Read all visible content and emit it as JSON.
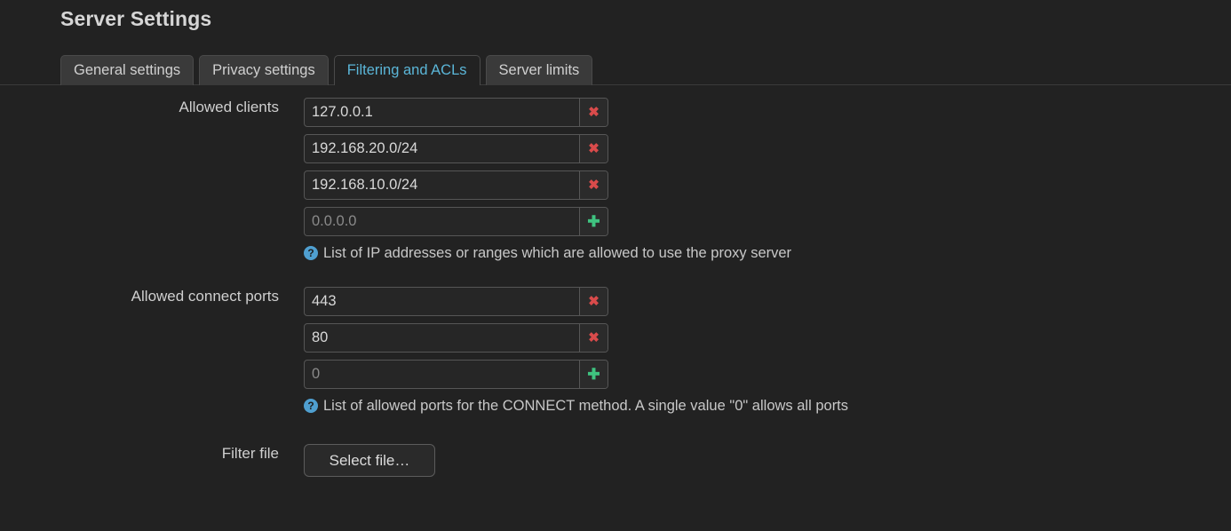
{
  "page": {
    "title": "Server Settings"
  },
  "tabs": [
    {
      "label": "General settings",
      "active": false
    },
    {
      "label": "Privacy settings",
      "active": false
    },
    {
      "label": "Filtering and ACLs",
      "active": true
    },
    {
      "label": "Server limits",
      "active": false
    }
  ],
  "fields": {
    "allowed_clients": {
      "label": "Allowed clients",
      "entries": [
        "127.0.0.1",
        "192.168.20.0/24",
        "192.168.10.0/24"
      ],
      "new_entry_placeholder": "0.0.0.0",
      "new_entry_value": "",
      "remove_label": "✖",
      "add_label": "✚",
      "help_icon": "question-mark",
      "help_icon_glyph": "?",
      "help": "List of IP addresses or ranges which are allowed to use the proxy server"
    },
    "allowed_connect_ports": {
      "label": "Allowed connect ports",
      "entries": [
        "443",
        "80"
      ],
      "new_entry_placeholder": "0",
      "new_entry_value": "",
      "remove_label": "✖",
      "add_label": "✚",
      "help_icon": "question-mark",
      "help_icon_glyph": "?",
      "help": "List of allowed ports for the CONNECT method. A single value \"0\" allows all ports"
    },
    "filter_file": {
      "label": "Filter file",
      "button_label": "Select file…"
    }
  },
  "colors": {
    "background": "#222222",
    "tab_inactive_bg": "#3a3a3a",
    "tab_active_text": "#5bb6d8",
    "input_bg": "#262626",
    "input_border": "#565656",
    "remove_icon": "#d94b4b",
    "add_icon": "#3fc380",
    "help_icon_bg": "#4f9fd0",
    "text": "#d4d4d4"
  }
}
